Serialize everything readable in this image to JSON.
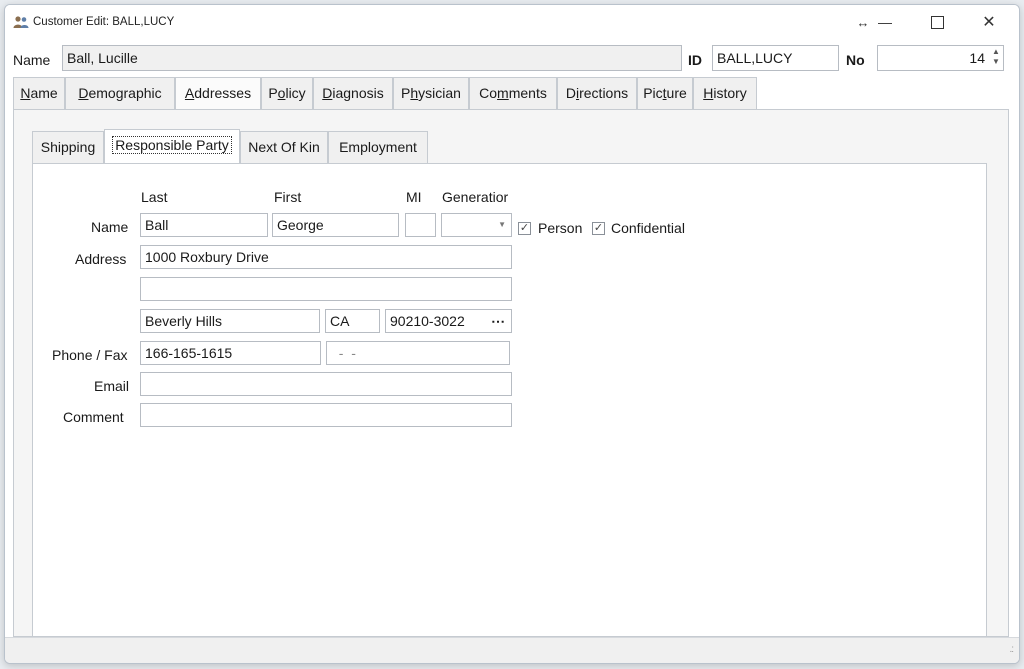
{
  "window": {
    "title": "Customer Edit: BALL,LUCY"
  },
  "header": {
    "name_label": "Name",
    "name_value": "Ball, Lucille",
    "id_label": "ID",
    "id_value": "BALL,LUCY",
    "no_label": "No",
    "no_value": "14"
  },
  "main_tabs": [
    {
      "pre": "",
      "ul": "N",
      "post": "ame"
    },
    {
      "pre": "",
      "ul": "D",
      "post": "emographic"
    },
    {
      "pre": "",
      "ul": "A",
      "post": "ddresses"
    },
    {
      "pre": "P",
      "ul": "o",
      "post": "licy"
    },
    {
      "pre": "",
      "ul": "D",
      "post": "iagnosis"
    },
    {
      "pre": "P",
      "ul": "h",
      "post": "ysician"
    },
    {
      "pre": "Co",
      "ul": "m",
      "post": "ments"
    },
    {
      "pre": "D",
      "ul": "i",
      "post": "rections"
    },
    {
      "pre": "Pic",
      "ul": "t",
      "post": "ure"
    },
    {
      "pre": "",
      "ul": "H",
      "post": "istory"
    }
  ],
  "sub_tabs": [
    "Shipping",
    "Responsible Party",
    "Next Of Kin",
    "Employment"
  ],
  "form": {
    "col_last": "Last",
    "col_first": "First",
    "col_mi": "MI",
    "col_generation": "Generatior",
    "name_label": "Name",
    "last": "Ball",
    "first": "George",
    "mi": "",
    "generation": "",
    "person_label": "Person",
    "confidential_label": "Confidential",
    "person_checked": true,
    "confidential_checked": true,
    "address_label": "Address",
    "address1": "1000 Roxbury Drive",
    "address2": "",
    "city": "Beverly Hills",
    "state": "CA",
    "zip": "90210-3022",
    "phone_label": "Phone / Fax",
    "phone": "166-165-1615",
    "fax": "  -  -",
    "email_label": "Email",
    "email": "",
    "comment_label": "Comment",
    "comment": ""
  }
}
